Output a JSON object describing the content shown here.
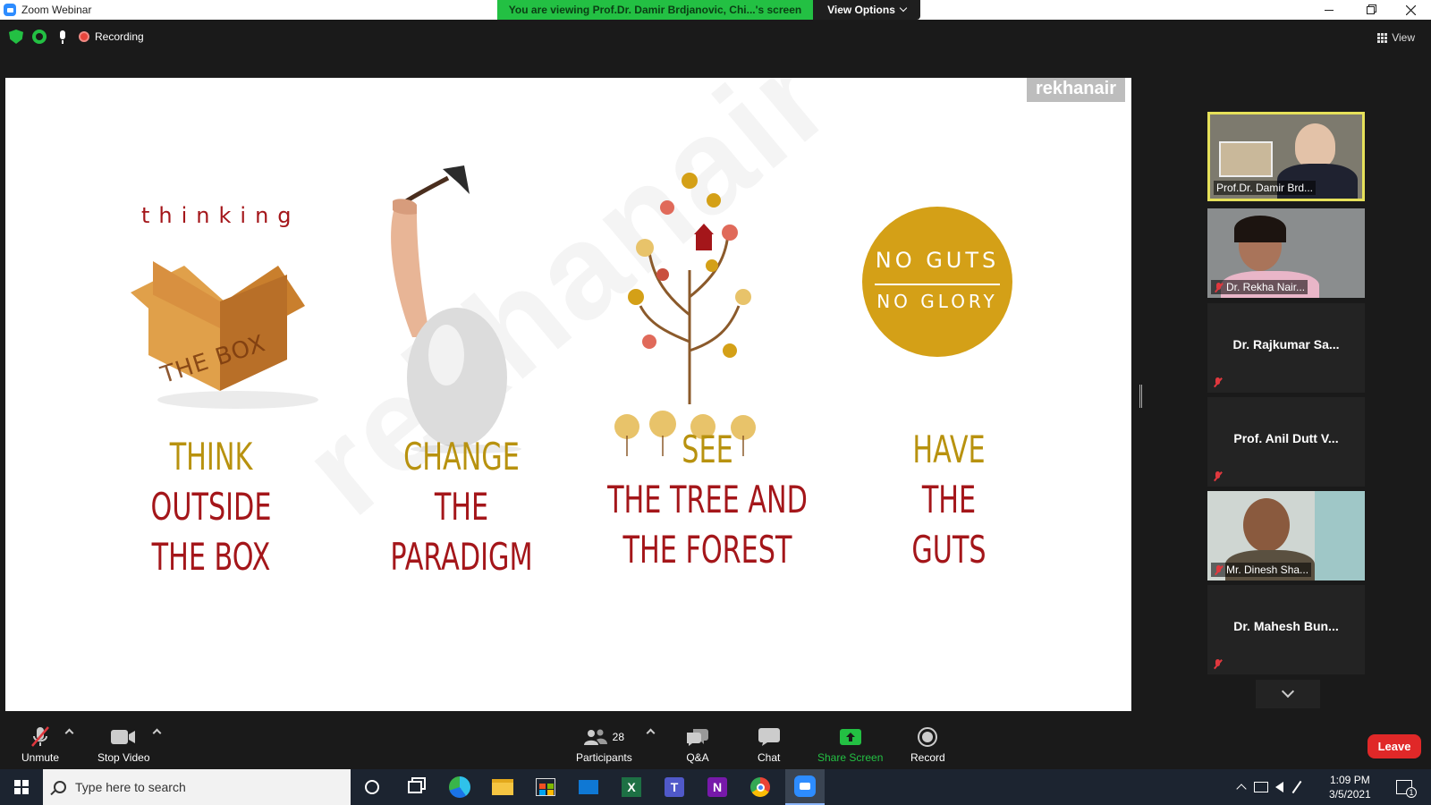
{
  "window": {
    "title": "Zoom Webinar",
    "viewing_banner": "You are viewing Prof.Dr. Damir Brdjanovic, Chi...'s screen",
    "view_options_label": "View Options"
  },
  "status": {
    "recording_label": "Recording",
    "view_label": "View"
  },
  "slide": {
    "watermark": "rekhanair",
    "box_caption": "thinking",
    "box_text": "THE BOX",
    "badge_line1": "NO GUTS",
    "badge_line2": "NO GLORY",
    "columns": [
      {
        "lines": [
          {
            "text": "THINK",
            "color": "gold"
          },
          {
            "text": "OUTSIDE",
            "color": "red"
          },
          {
            "text": "THE BOX",
            "color": "red"
          }
        ]
      },
      {
        "lines": [
          {
            "text": "CHANGE",
            "color": "gold"
          },
          {
            "text": "THE",
            "color": "red"
          },
          {
            "text": "PARADIGM",
            "color": "red"
          }
        ]
      },
      {
        "lines": [
          {
            "text": "SEE",
            "color": "gold"
          },
          {
            "text": "THE TREE AND",
            "color": "red"
          },
          {
            "text": "THE FOREST",
            "color": "red"
          }
        ]
      },
      {
        "lines": [
          {
            "text": "HAVE",
            "color": "gold"
          },
          {
            "text": "THE",
            "color": "red"
          },
          {
            "text": "GUTS",
            "color": "red"
          }
        ]
      }
    ],
    "colors": {
      "gold": "#b8920f",
      "red": "#a4161a",
      "badge": "#d4a017"
    }
  },
  "participants": [
    {
      "name": "Prof.Dr. Damir Brd...",
      "video": true,
      "active": true,
      "muted": false
    },
    {
      "name": "Dr. Rekha Nair...",
      "video": true,
      "active": false,
      "muted": true
    },
    {
      "name": "Dr. Rajkumar Sa...",
      "video": false,
      "active": false,
      "muted": true
    },
    {
      "name": "Prof. Anil Dutt V...",
      "video": false,
      "active": false,
      "muted": true
    },
    {
      "name": "Mr. Dinesh Sha...",
      "video": true,
      "active": false,
      "muted": true
    },
    {
      "name": "Dr. Mahesh Bun...",
      "video": false,
      "active": false,
      "muted": true
    }
  ],
  "toolbar": {
    "unmute": "Unmute",
    "stop_video": "Stop Video",
    "participants": "Participants",
    "participants_count": "28",
    "qa": "Q&A",
    "chat": "Chat",
    "share_screen": "Share Screen",
    "record": "Record",
    "leave": "Leave"
  },
  "taskbar": {
    "search_placeholder": "Type here to search",
    "time": "1:09 PM",
    "date": "3/5/2021",
    "notification_count": "1"
  }
}
